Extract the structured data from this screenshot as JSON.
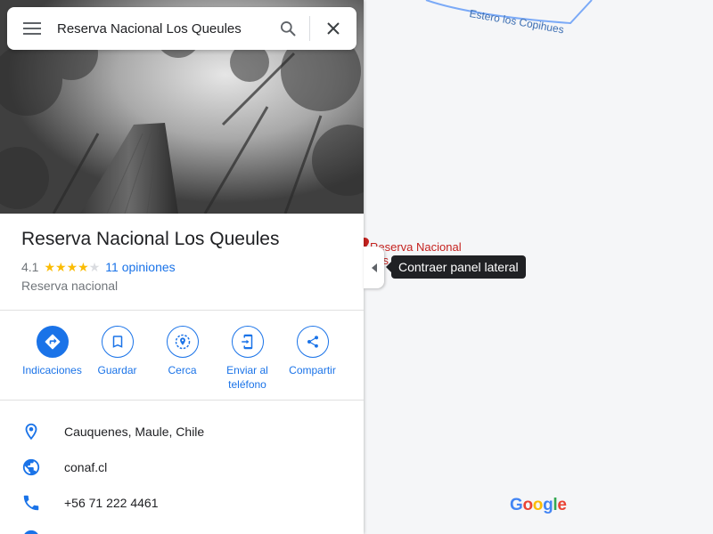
{
  "search": {
    "query": "Reserva Nacional Los Queules"
  },
  "place": {
    "name": "Reserva Nacional Los Queules",
    "rating": "4.1",
    "stars_filled": 4,
    "stars_total": 5,
    "reviews_label": "11 opiniones",
    "category": "Reserva nacional"
  },
  "actions": [
    {
      "label": "Indicaciones",
      "icon": "directions-icon"
    },
    {
      "label": "Guardar",
      "icon": "bookmark-icon"
    },
    {
      "label": "Cerca",
      "icon": "nearby-icon"
    },
    {
      "label": "Enviar al teléfono",
      "icon": "send-to-phone-icon"
    },
    {
      "label": "Compartir",
      "icon": "share-icon"
    }
  ],
  "info": {
    "address": "Cauquenes, Maule, Chile",
    "website": "conaf.cl",
    "phone": "+56 71 222 4461"
  },
  "map": {
    "stream_label": "Estero los Copihues",
    "place_label": "Reserva Nacional Los Queules"
  },
  "tooltip": "Contraer panel lateral",
  "brand": {
    "blue": "#1a73e8",
    "star": "#fbbc04",
    "place_red": "#c5221f"
  }
}
